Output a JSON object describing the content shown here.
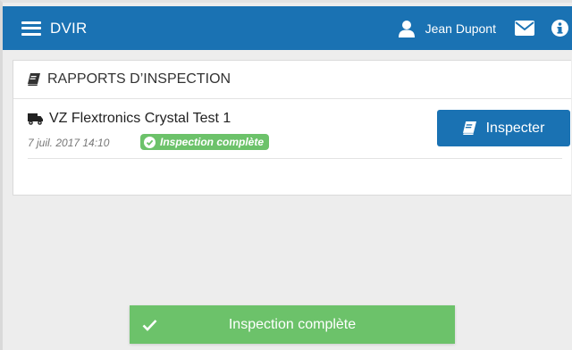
{
  "header": {
    "title": "DVIR",
    "user_name": "Jean Dupont",
    "icons": [
      "menu-icon",
      "user-icon",
      "envelope-icon",
      "info-icon"
    ],
    "color": "#1a72b3"
  },
  "section": {
    "title": "RAPPORTS D’INSPECTION",
    "icon": "book-icon"
  },
  "reports": [
    {
      "vehicle": "VZ Flextronics Crystal Test 1",
      "date": "7 juil. 2017 14:10",
      "status": "Inspection complète",
      "action_label": "Inspecter"
    }
  ],
  "toast": {
    "message": "Inspection complète",
    "color": "#6cc26a"
  }
}
